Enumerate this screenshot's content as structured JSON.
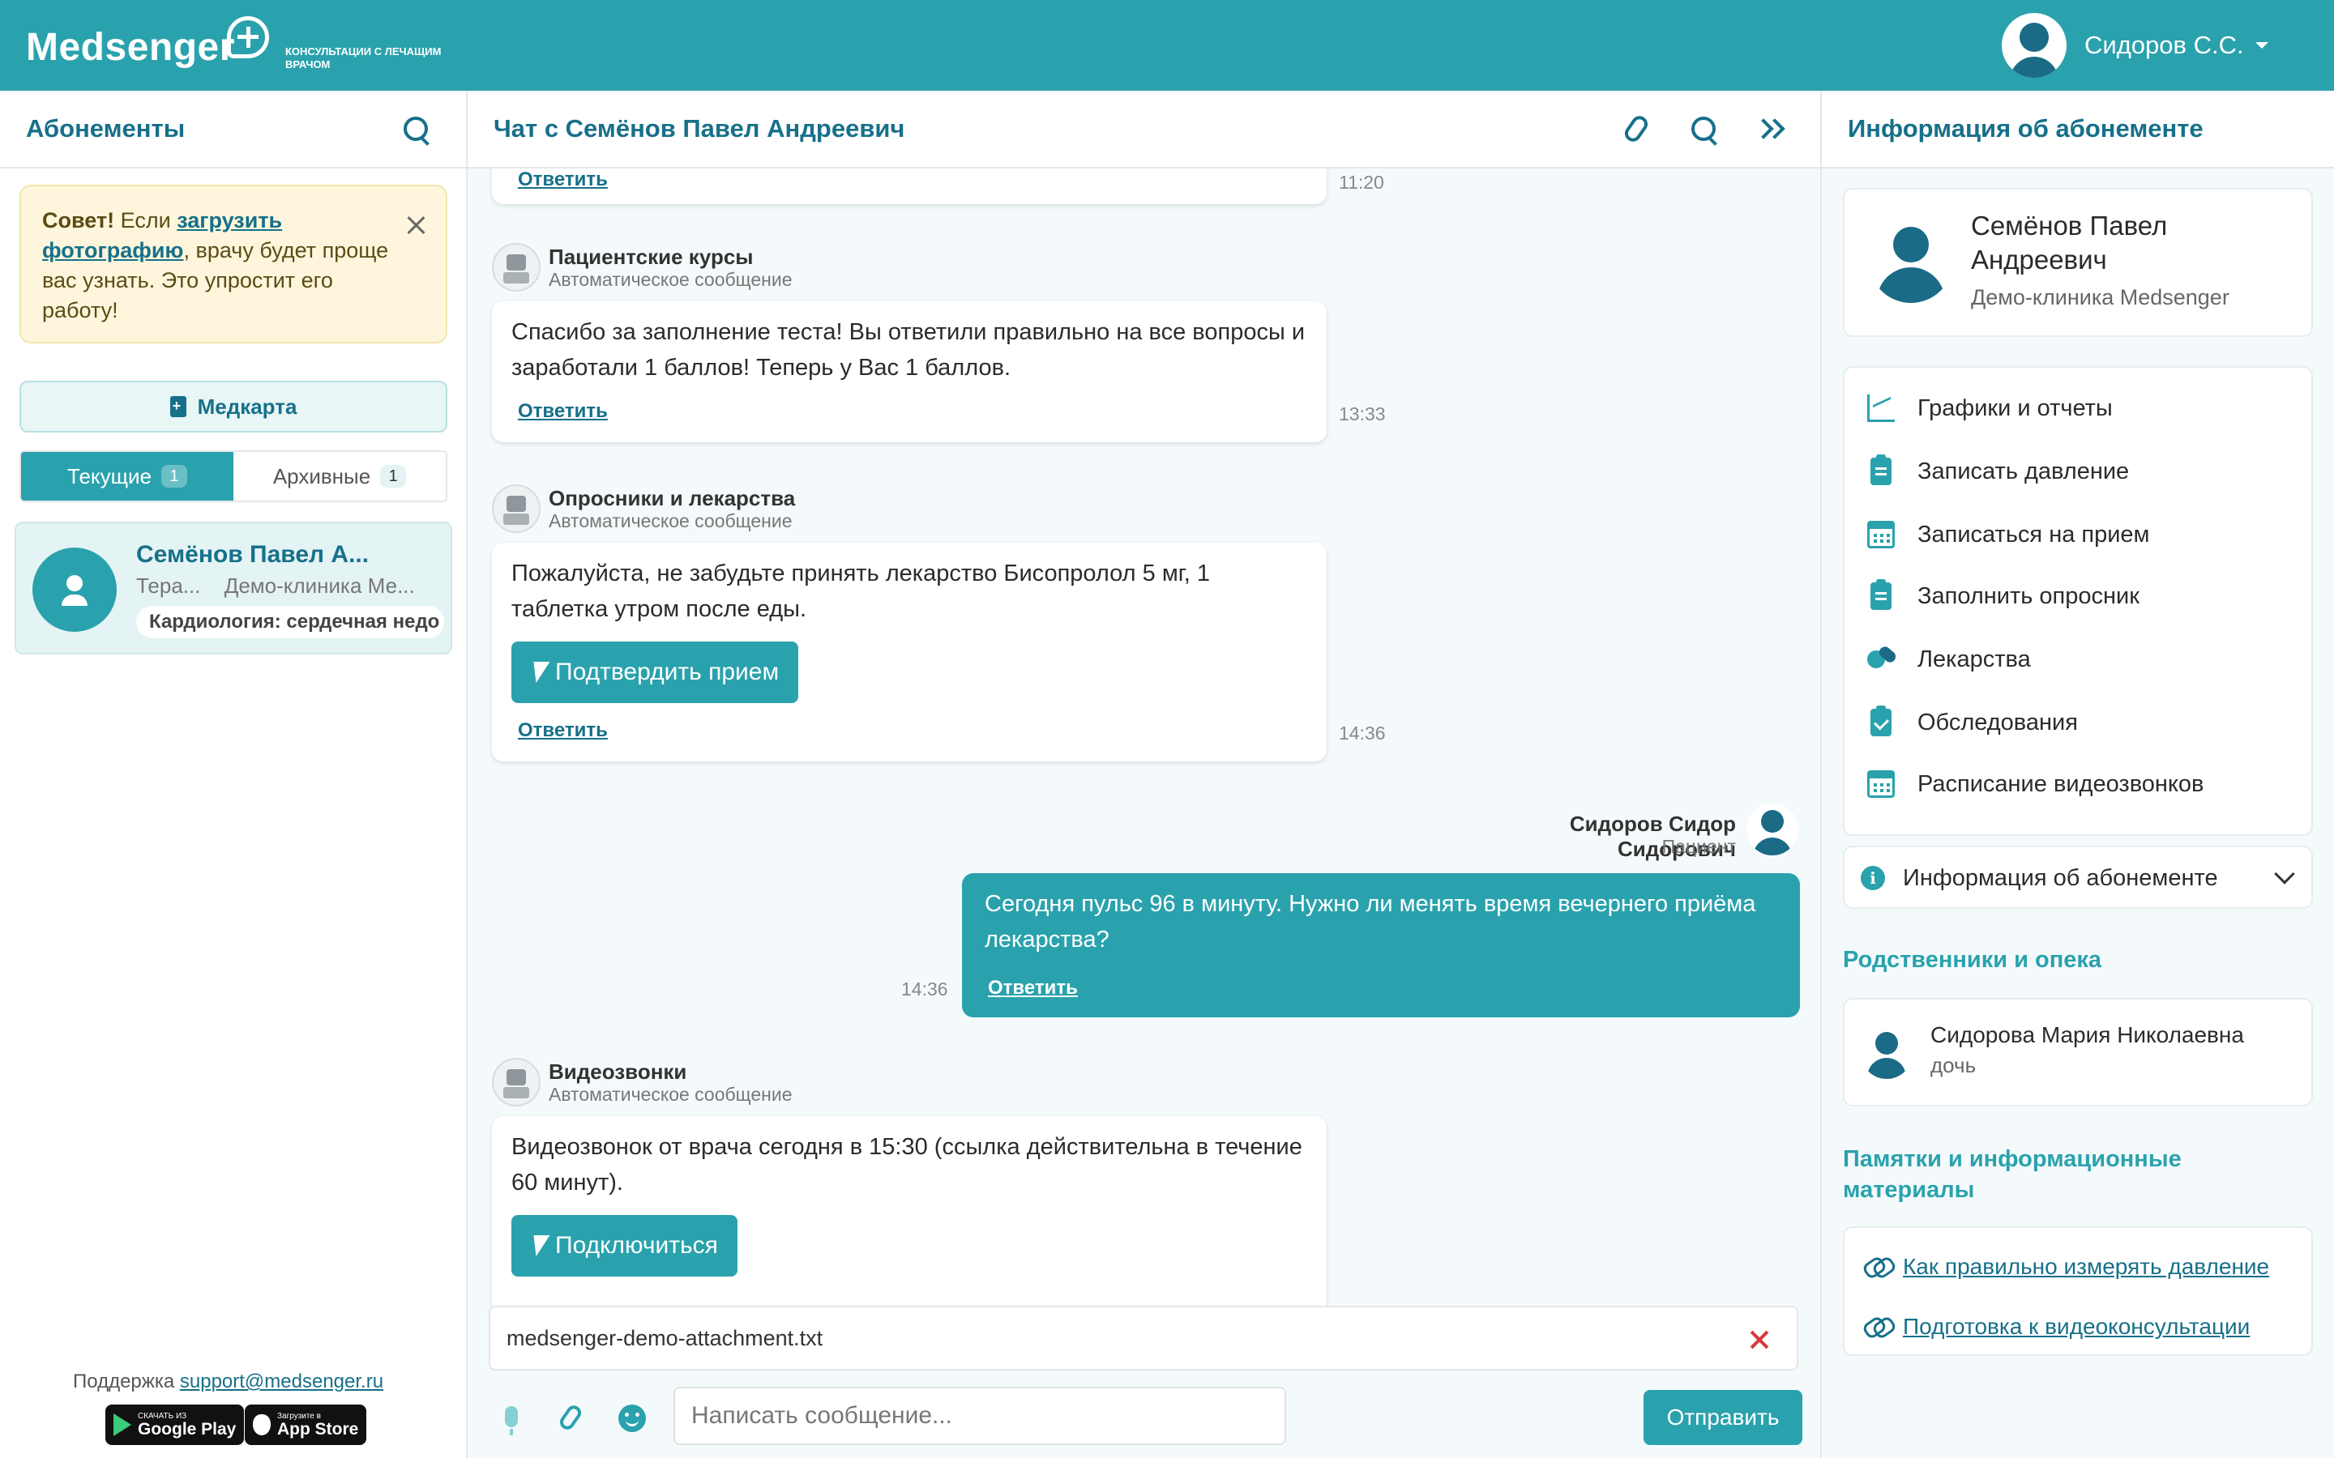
{
  "header": {
    "logo_text": "Medsenger",
    "logo_tagline": "Консультации с лечащим врачом",
    "user_name": "Сидоров С.С."
  },
  "left": {
    "title": "Абонементы",
    "tip": {
      "bold": "Совет!",
      "pre": "Если",
      "link": "загрузить фотографию",
      "post": ", врачу будет проще вас узнать. Это упростит его работу!"
    },
    "medcard_label": "Медкарта",
    "tabs": [
      {
        "label": "Текущие",
        "count": "1"
      },
      {
        "label": "Архивные",
        "count": "1"
      }
    ],
    "subscription": {
      "name": "Семёнов Павел А...",
      "specialty": "Тера...",
      "clinic": "Демо-клиника Ме...",
      "tag": "Кардиология: сердечная недо"
    },
    "support_label": "Поддержка",
    "support_email": "support@medsenger.ru",
    "google_small": "СКАЧАТЬ ИЗ",
    "google_big": "Google Play",
    "apple_small": "Загрузите в",
    "apple_big": "App Store"
  },
  "chat": {
    "title": "Чат с Семёнов Павел Андреевич",
    "top_partial": {
      "reply": "Ответить",
      "time": "11:20"
    },
    "messages": [
      {
        "sender": "Пациентские курсы",
        "sub": "Автоматическое сообщение",
        "text": "Спасибо за заполнение теста! Вы ответили правильно на все вопросы и заработали 1 баллов! Теперь у Вас 1 баллов.",
        "reply": "Ответить",
        "time": "13:33"
      },
      {
        "sender": "Опросники и лекарства",
        "sub": "Автоматическое сообщение",
        "text": "Пожалуйста, не забудьте принять лекарство Бисопролол 5 мг, 1 таблетка утром после еды.",
        "button": "Подтвердить прием",
        "reply": "Ответить",
        "time": "14:36"
      },
      {
        "sender": "Сидоров Сидор Сидорович",
        "sub": "Пациент",
        "text": "Сегодня пульс 96 в минуту. Нужно ли менять время вечернего приёма лекарства?",
        "reply": "Ответить",
        "time": "14:36"
      },
      {
        "sender": "Видеозвонки",
        "sub": "Автоматическое сообщение",
        "text": "Видеозвонок от врача сегодня в 15:30 (ссылка действительна в течение 60 минут).",
        "button": "Подключиться"
      }
    ],
    "attachment_name": "medsenger-demo-attachment.txt",
    "input_placeholder": "Написать сообщение...",
    "send_label": "Отправить"
  },
  "right": {
    "title": "Информация об абонементе",
    "patient_name": "Семёнов Павел Андреевич",
    "patient_clinic": "Демо-клиника Medsenger",
    "menu": [
      {
        "label": "Графики и отчеты",
        "icon": "chart-icon"
      },
      {
        "label": "Записать давление",
        "icon": "clipboard-icon"
      },
      {
        "label": "Записаться на прием",
        "icon": "calendar-icon"
      },
      {
        "label": "Заполнить опросник",
        "icon": "clipboard-icon"
      },
      {
        "label": "Лекарства",
        "icon": "pills-icon"
      },
      {
        "label": "Обследования",
        "icon": "clipboard-check-icon"
      },
      {
        "label": "Расписание видеозвонков",
        "icon": "calendar-icon"
      }
    ],
    "info_label": "Информация об абонементе",
    "relatives_title": "Родственники и опека",
    "relative_name": "Сидорова Мария Николаевна",
    "relative_role": "дочь",
    "materials_title": "Памятки и информационные материалы",
    "links": [
      "Как правильно измерять давление",
      "Подготовка к видеоконсультации"
    ]
  }
}
